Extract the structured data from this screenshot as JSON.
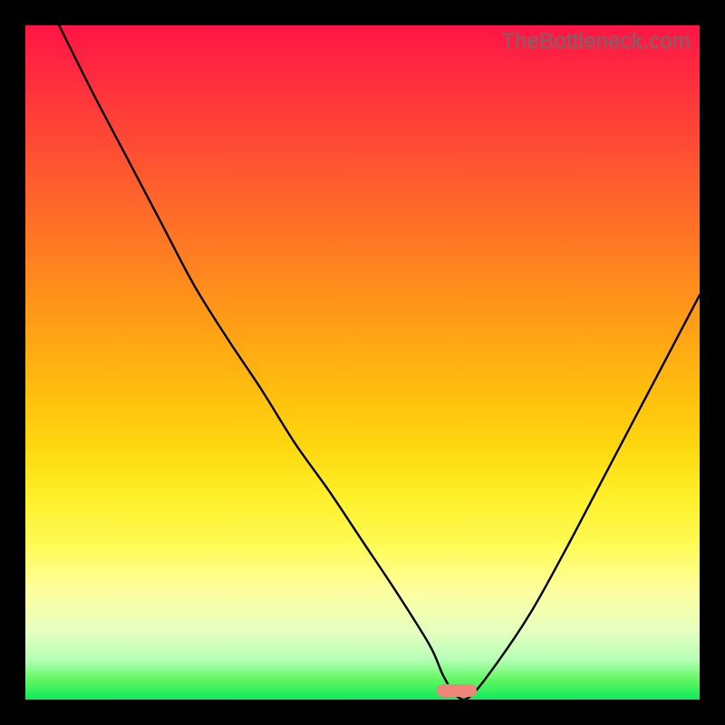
{
  "watermark": "TheBottleneck.com",
  "chart_data": {
    "type": "line",
    "title": "",
    "xlabel": "",
    "ylabel": "",
    "xlim": [
      0,
      100
    ],
    "ylim": [
      0,
      100
    ],
    "marker": {
      "x_start": 61,
      "x_end": 67,
      "y": 0.5
    },
    "series": [
      {
        "name": "bottleneck-curve",
        "x": [
          5,
          10,
          15,
          20,
          25,
          30,
          35,
          40,
          45,
          50,
          55,
          60,
          62,
          64,
          66,
          70,
          75,
          80,
          85,
          90,
          95,
          100
        ],
        "y": [
          100,
          90,
          80.5,
          71,
          61.5,
          53.5,
          46,
          38,
          31,
          23.5,
          16,
          8,
          3.5,
          0.5,
          0.5,
          5.5,
          13,
          22,
          31.5,
          41,
          50.5,
          60
        ]
      }
    ],
    "gradient_stops": [
      {
        "pos": 0.0,
        "color": "#ff1545"
      },
      {
        "pos": 0.5,
        "color": "#ffad12"
      },
      {
        "pos": 0.75,
        "color": "#fffb55"
      },
      {
        "pos": 1.0,
        "color": "#0eea5a"
      }
    ]
  }
}
